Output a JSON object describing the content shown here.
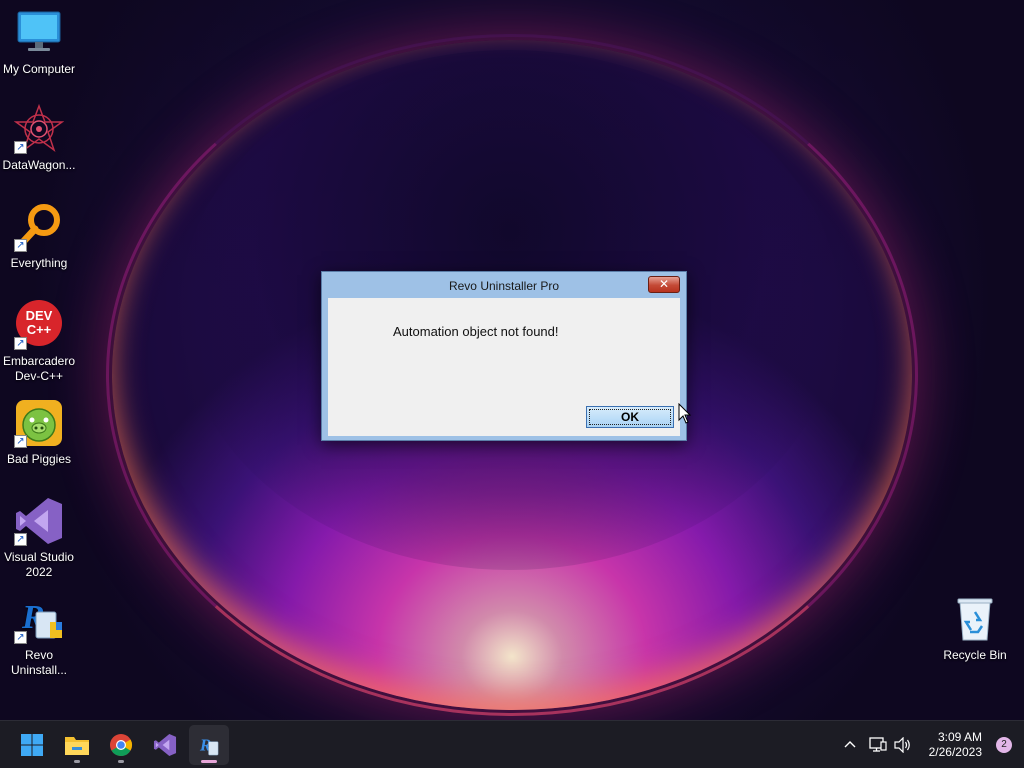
{
  "desktop": {
    "icons": [
      {
        "label_1": "My Computer",
        "label_2": ""
      },
      {
        "label_1": "DataWagon...",
        "label_2": ""
      },
      {
        "label_1": "Everything",
        "label_2": ""
      },
      {
        "label_1": "Embarcadero",
        "label_2": "Dev-C++"
      },
      {
        "label_1": "Bad Piggies",
        "label_2": ""
      },
      {
        "label_1": "Visual Studio",
        "label_2": "2022"
      },
      {
        "label_1": "Revo",
        "label_2": "Uninstall..."
      },
      {
        "label_1": "Recycle Bin",
        "label_2": ""
      }
    ],
    "devcpp_icon_text_1": "DEV",
    "devcpp_icon_text_2": "C++"
  },
  "dialog": {
    "title": "Revo Uninstaller Pro",
    "close_label": "✕",
    "message": "Automation object not found!",
    "ok_label": "OK"
  },
  "taskbar": {
    "apps": [
      "start-icon",
      "file-explorer-icon",
      "chrome-icon",
      "visual-studio-icon",
      "revo-uninstaller-icon"
    ],
    "tray_chevron": "^",
    "time": "3:09 AM",
    "date": "2/26/2023",
    "notification_count": "2"
  },
  "colors": {
    "dialog_frame": "#9ec1e6",
    "close_button": "#c44a36",
    "ok_button": "#a9d3f5",
    "taskbar": "#1c1c24",
    "active_indicator": "#e7a6d8"
  }
}
